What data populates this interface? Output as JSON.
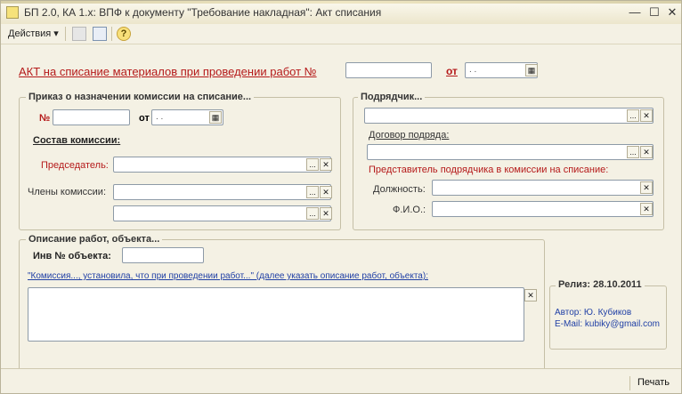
{
  "window": {
    "title": "БП 2.0, КА 1.х: ВПФ к документу \"Требование накладная\": Акт списания"
  },
  "toolbar": {
    "actions_label": "Действия",
    "actions_arrow": "▾",
    "help_glyph": "?"
  },
  "header": {
    "act_label": "АКТ на списание материалов при проведении работ №",
    "ot_label": "от",
    "date_placeholder": ". ."
  },
  "order": {
    "legend": "Приказ о назначении комиссии на списание...",
    "number_label": "№",
    "ot_label": "от",
    "date_placeholder": ". .",
    "composition_label": "Состав комиссии:",
    "chairman_label": "Председатель:",
    "members_label": "Члены комиссии:"
  },
  "contractor": {
    "legend": "Подрядчик...",
    "contract_label": "Договор подряда:",
    "representative_label": "Представитель подрядчика в комиссии на списание:",
    "position_label": "Должность:",
    "fio_label": "Ф.И.О.:"
  },
  "works": {
    "legend": "Описание работ, объекта...",
    "inv_label": "Инв № объекта:",
    "description_link": "\"Комиссия..., установила, что при проведении работ...\" (далее указать описание работ, объекта):"
  },
  "release": {
    "legend": "Релиз: 28.10.2011",
    "author": "Автор: Ю. Кубиков",
    "email": "E-Mail: kubiky@gmail.com"
  },
  "footer": {
    "print_label": "Печать"
  },
  "icons": {
    "choose": "...",
    "clear": "✕",
    "calendar": "▦",
    "minimize": "—",
    "maximize": "☐",
    "close": "✕"
  }
}
